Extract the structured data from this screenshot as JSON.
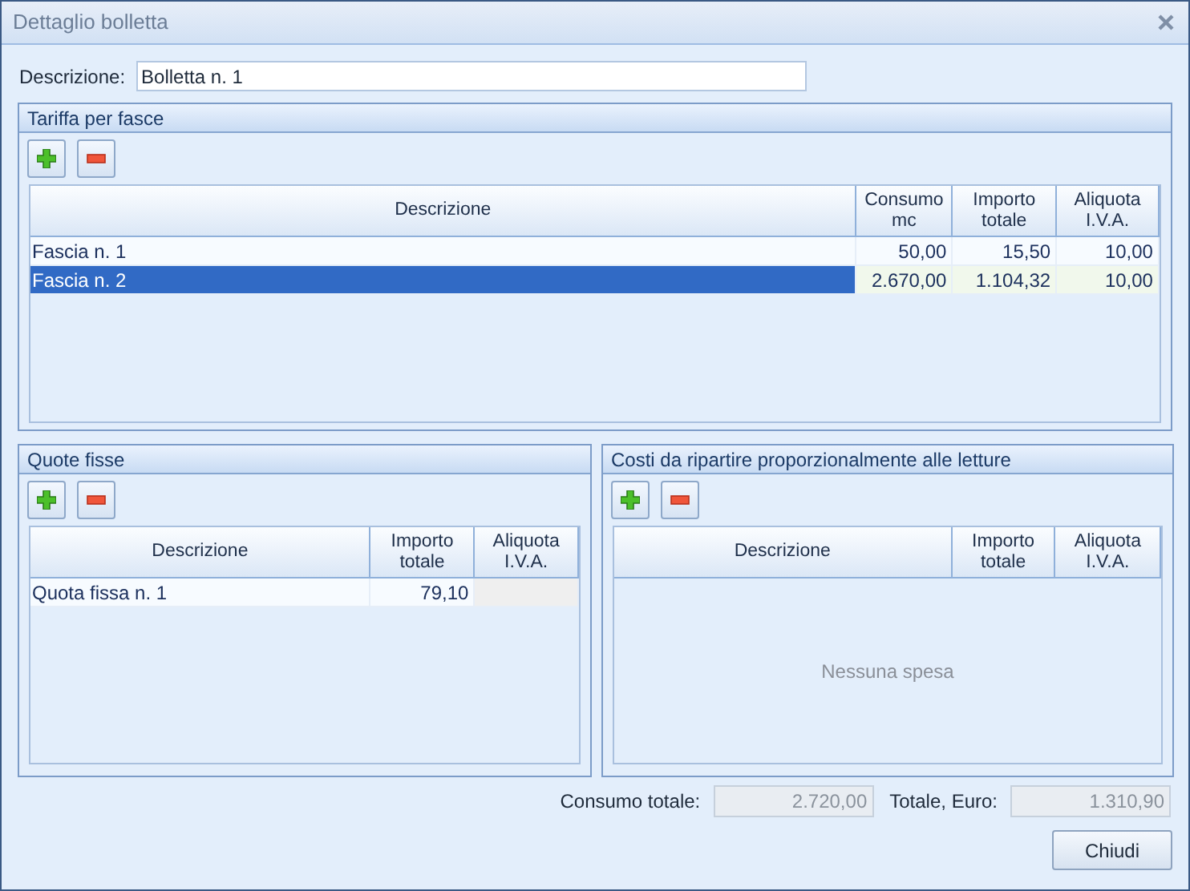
{
  "window": {
    "title": "Dettaglio bolletta"
  },
  "description": {
    "label": "Descrizione:",
    "value": "Bolletta n. 1"
  },
  "sections": [
    {
      "title": "Tariffa per fasce",
      "columns": [
        "Descrizione",
        "Consumo mc",
        "Importo totale",
        "Aliquota I.V.A."
      ],
      "rows": [
        {
          "cells": [
            "Fascia n. 1",
            "50,00",
            "15,50",
            "10,00"
          ],
          "selected": false
        },
        {
          "cells": [
            "Fascia n. 2",
            "2.670,00",
            "1.104,32",
            "10,00"
          ],
          "selected": true
        }
      ]
    },
    {
      "title": "Quote fisse",
      "columns": [
        "Descrizione",
        "Importo totale",
        "Aliquota I.V.A."
      ],
      "rows": [
        {
          "cells": [
            "Quota fissa n. 1",
            "79,10"
          ],
          "selected": false
        }
      ]
    },
    {
      "title": "Costi da ripartire proporzionalmente alle letture",
      "columns": [
        "Descrizione",
        "Importo totale",
        "Aliquota I.V.A."
      ],
      "empty_text": "Nessuna spesa"
    }
  ],
  "totals": [
    {
      "label": "Consumo totale:",
      "value": "2.720,00",
      "disabled": true
    },
    {
      "label": "Totale, Euro:",
      "value": "1.310,90",
      "disabled": true
    }
  ],
  "close_button": "Chiudi"
}
